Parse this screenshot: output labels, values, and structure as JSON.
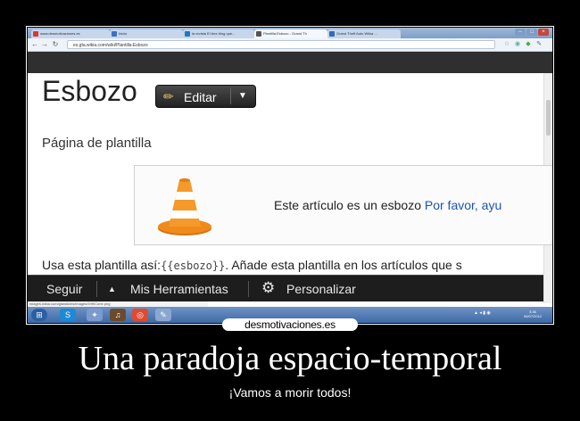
{
  "browser": {
    "tabs": [
      {
        "label": "www.desmotivaciones.es",
        "favicon_color": "#d43b2b"
      },
      {
        "label": "Inicio",
        "favicon_color": "#3b73c4"
      },
      {
        "label": "la revista El free blog que...",
        "favicon_color": "#1f78c1"
      },
      {
        "label": "Plantilla:Esbozo - Grand Th",
        "favicon_color": "#555555"
      },
      {
        "label": "Grand Theft Auto Wikia ...",
        "favicon_color": "#2d6db5"
      }
    ],
    "url": "es.gta.wikia.com/wiki/Plantilla:Esbozo",
    "statusbar_url": "images.wikia.com/gtawiki/es/images/9/9f/Cone.png"
  },
  "page": {
    "title": "Esbozo",
    "edit_button": "Editar",
    "subtitle": "Página de plantilla",
    "notice_text": "Este artículo es un esbozo ",
    "notice_link": "Por favor, ayu",
    "usage_prefix": "Usa esta plantilla así:",
    "usage_code": "{{esbozo}}",
    "usage_suffix": ". Añade esta plantilla en los artículos que s"
  },
  "toolbar": {
    "follow": "Seguir",
    "my_tools": "Mis Herramientas",
    "customize": "Personalizar"
  },
  "taskbar": {
    "clock_time": "3:36",
    "clock_date": "06/07/2012"
  },
  "poster": {
    "watermark": "desmotivaciones.es",
    "caption": "Una paradoja espacio-temporal",
    "tagline": "¡Vamos a morir todos!"
  },
  "colors": {
    "link": "#1a55b4",
    "toolbar_bg": "#1d1d1d",
    "edit_button_bg": "#333333"
  }
}
